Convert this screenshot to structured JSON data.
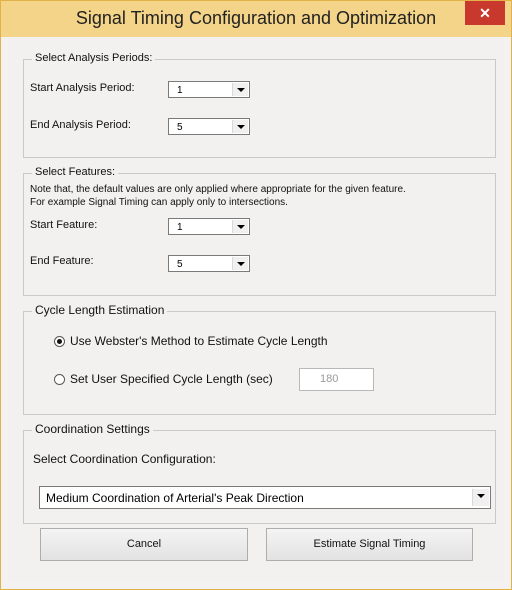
{
  "window": {
    "title": "Signal Timing Configuration and Optimization",
    "close_glyph": "✕"
  },
  "analysis_periods": {
    "legend": "Select Analysis Periods:",
    "start_label": "Start Analysis Period:",
    "start_value": "1",
    "end_label": "End Analysis Period:",
    "end_value": "5"
  },
  "features": {
    "legend": "Select Features:",
    "note_line1": "Note that, the default values are only applied where appropriate for the given feature.",
    "note_line2": "For example Signal Timing can apply only to intersections.",
    "start_label": "Start Feature:",
    "start_value": "1",
    "end_label": "End Feature:",
    "end_value": "5"
  },
  "cycle_length": {
    "legend": "Cycle Length Estimation",
    "option_webster": "Use Webster's Method to Estimate Cycle Length",
    "webster_selected": true,
    "option_user": "Set User Specified Cycle Length (sec)",
    "user_value": "180"
  },
  "coordination": {
    "legend": "Coordination Settings",
    "select_label": "Select Coordination Configuration:",
    "selected_value": "Medium Coordination of Arterial's Peak Direction"
  },
  "buttons": {
    "cancel": "Cancel",
    "estimate": "Estimate Signal Timing"
  },
  "colors": {
    "titlebar": "#f3d488",
    "close_button": "#c9382c",
    "dialog_bg": "#f3f1ef"
  }
}
